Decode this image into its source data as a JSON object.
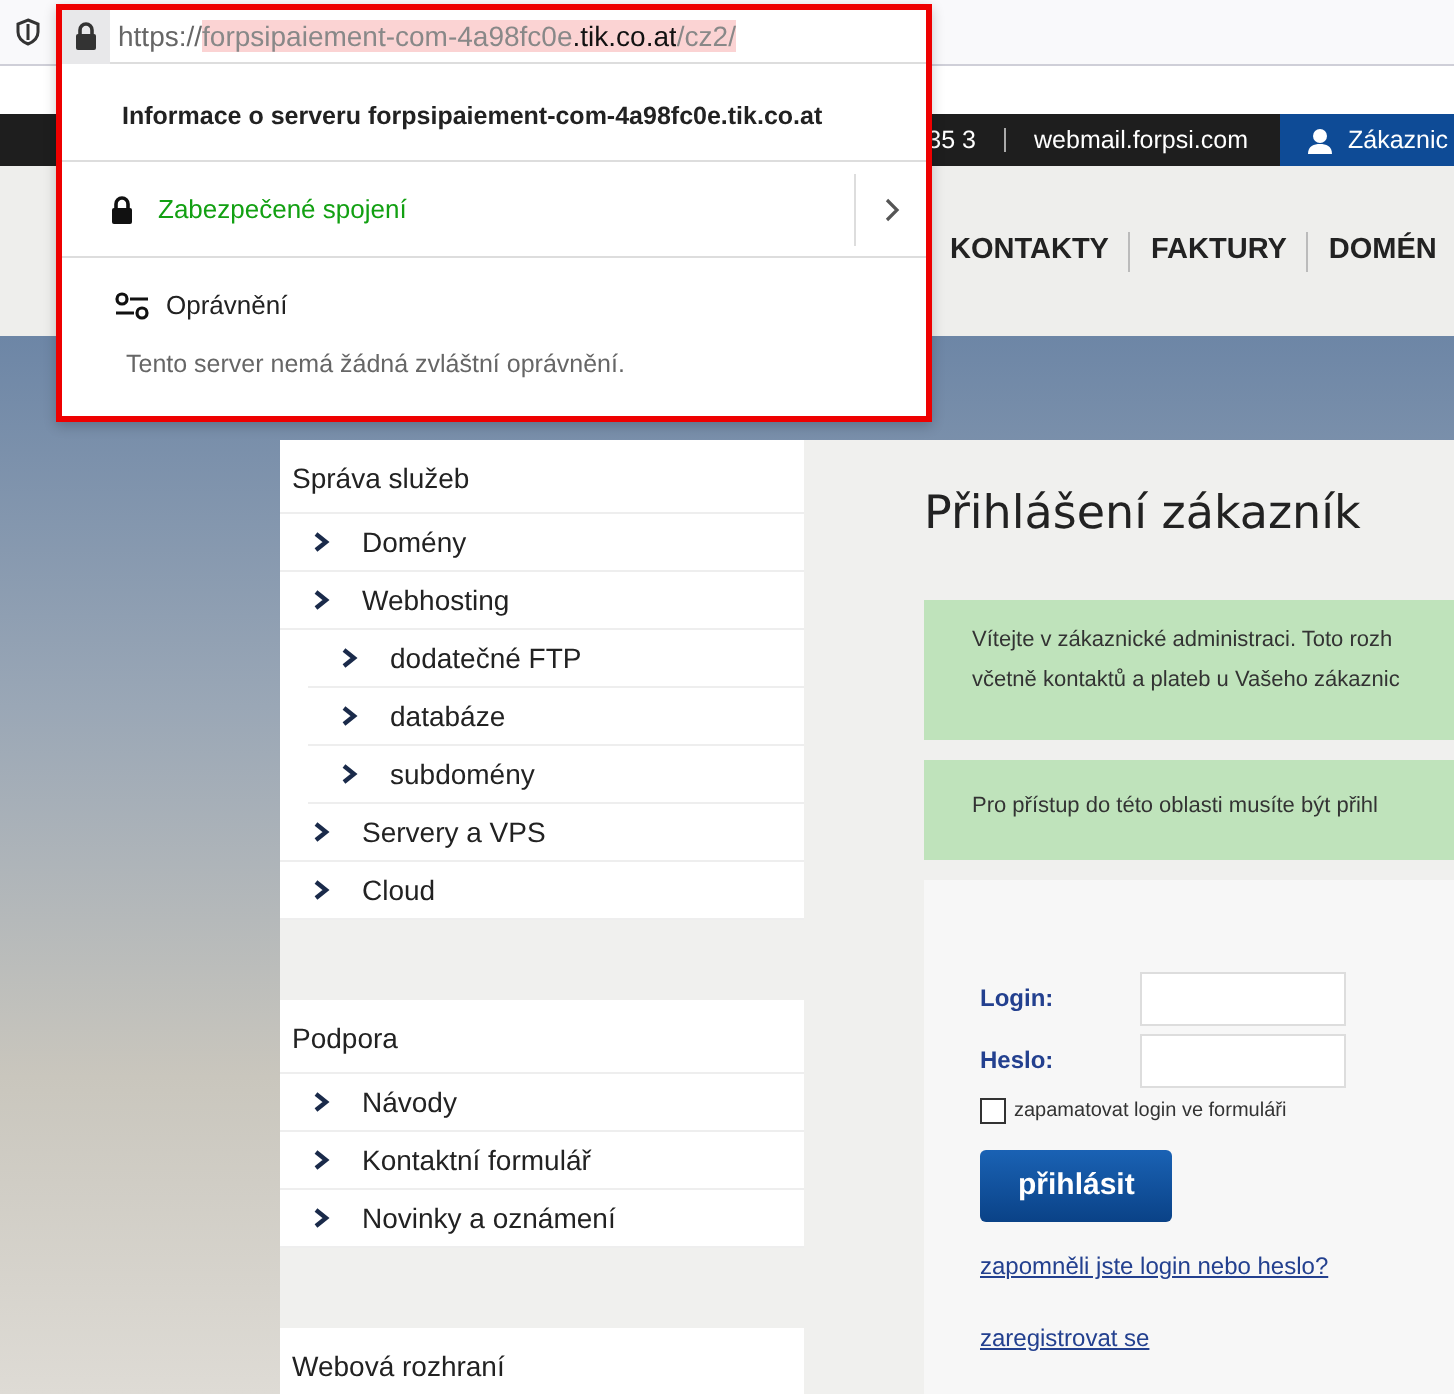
{
  "browser": {
    "url_parts": [
      {
        "text": "https://",
        "kind": "scheme"
      },
      {
        "text": "forpsipaiement-com-4a98fc0e",
        "kind": "host"
      },
      {
        "text": ".tik.co.at",
        "kind": "domain"
      },
      {
        "text": "/cz2/",
        "kind": "path"
      }
    ],
    "popup": {
      "title": "Informace o serveru forpsipaiement-com-4a98fc0e.tik.co.at",
      "connection": "Zabezpečené spojení",
      "permissions_title": "Oprávnění",
      "permissions_text": "Tento server nemá žádná zvláštní oprávnění."
    }
  },
  "top_bar": {
    "items": [
      "35 3",
      "webmail.forpsi.com"
    ],
    "account": "Zákaznic"
  },
  "nav": {
    "items": [
      "KONTAKTY",
      "FAKTURY",
      "DOMÉN"
    ]
  },
  "sidebar": {
    "sections": [
      {
        "title": "Správa služeb",
        "items": [
          {
            "label": "Domény"
          },
          {
            "label": "Webhosting",
            "children": [
              {
                "label": "dodatečné FTP"
              },
              {
                "label": "databáze"
              },
              {
                "label": "subdomény"
              }
            ]
          },
          {
            "label": "Servery a VPS"
          },
          {
            "label": "Cloud"
          }
        ]
      },
      {
        "title": "Podpora",
        "items": [
          {
            "label": "Návody"
          },
          {
            "label": "Kontaktní formulář"
          },
          {
            "label": "Novinky a oznámení"
          }
        ]
      },
      {
        "title": "Webová rozhraní"
      }
    ]
  },
  "main": {
    "heading": "Přihlášení zákazník",
    "notices": [
      {
        "lines": [
          "Vítejte v zákaznické administraci. Toto rozh",
          "včetně kontaktů a plateb u Vašeho zákaznic"
        ]
      },
      {
        "lines": [
          "Pro přístup do této oblasti musíte být přihl"
        ]
      }
    ]
  },
  "login": {
    "fields": [
      {
        "label": "Login:"
      },
      {
        "label": "Heslo:"
      }
    ],
    "remember": {
      "label": "zapamatovat login ve formuláři",
      "checked": false
    },
    "submit": "přihlásit",
    "links": [
      "zapomněli jste login nebo heslo?",
      "zaregistrovat se"
    ]
  }
}
